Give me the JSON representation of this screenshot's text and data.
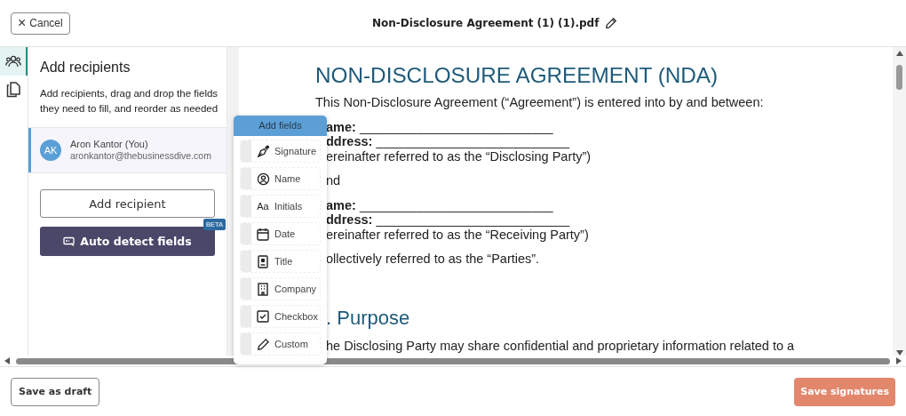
{
  "header": {
    "cancel": "Cancel",
    "cancel_icon": "×",
    "title": "Non-Disclosure Agreement (1) (1).pdf"
  },
  "rail": [
    {
      "kind": "people",
      "selected": true
    },
    {
      "kind": "pages",
      "selected": false
    }
  ],
  "sidebar": {
    "title": "Add recipients",
    "description": "Add recipients, drag and drop the fields they need to fill, and reorder as needed",
    "recipients": [
      {
        "initials": "AK",
        "name": "Aron Kantor (You)",
        "email": "aronkantor@thebusinessdive.com",
        "selected": true,
        "color": "#5a9fd6"
      }
    ],
    "add_button": "Add recipient",
    "auto_button": "Auto detect fields",
    "badge": "BETA"
  },
  "fields_popover": {
    "title": "Add fields",
    "items": [
      {
        "kind": "signature",
        "label": "Signature"
      },
      {
        "kind": "name",
        "label": "Name"
      },
      {
        "kind": "initials",
        "label": "Initials",
        "glyph": "Aa"
      },
      {
        "kind": "date",
        "label": "Date"
      },
      {
        "kind": "title",
        "label": "Title"
      },
      {
        "kind": "company",
        "label": "Company"
      },
      {
        "kind": "checkbox",
        "label": "Checkbox"
      },
      {
        "kind": "custom",
        "label": "Custom"
      }
    ]
  },
  "document": {
    "lines": [
      {
        "kind": "title",
        "text": "NON-DISCLOSURE AGREEMENT (NDA)"
      },
      {
        "kind": "intro",
        "text": "This Non-Disclosure Agreement (“Agreement”) is entered into by and between:"
      },
      {
        "kind": "field",
        "text": "**ame:** ___________________________"
      },
      {
        "kind": "field",
        "text": "**ddress:** ___________________________"
      },
      {
        "kind": "para",
        "text": "ereinafter referred to as the “Disclosing Party”)"
      },
      {
        "kind": "gap",
        "text": "nd"
      },
      {
        "kind": "field",
        "text": "**ame:** ___________________________"
      },
      {
        "kind": "field",
        "text": "**ddress:** ___________________________"
      },
      {
        "kind": "para",
        "text": "ereinafter referred to as the “Receiving Party”)"
      },
      {
        "kind": "gap",
        "text": "ollectively referred to as the “Parties”."
      },
      {
        "kind": "heading",
        "text": ". Purpose"
      },
      {
        "kind": "gap",
        "text": "he Disclosing Party may share confidential and proprietary information related to a"
      }
    ]
  },
  "footer": {
    "draft": "Save as draft",
    "save": "Save signatures"
  }
}
